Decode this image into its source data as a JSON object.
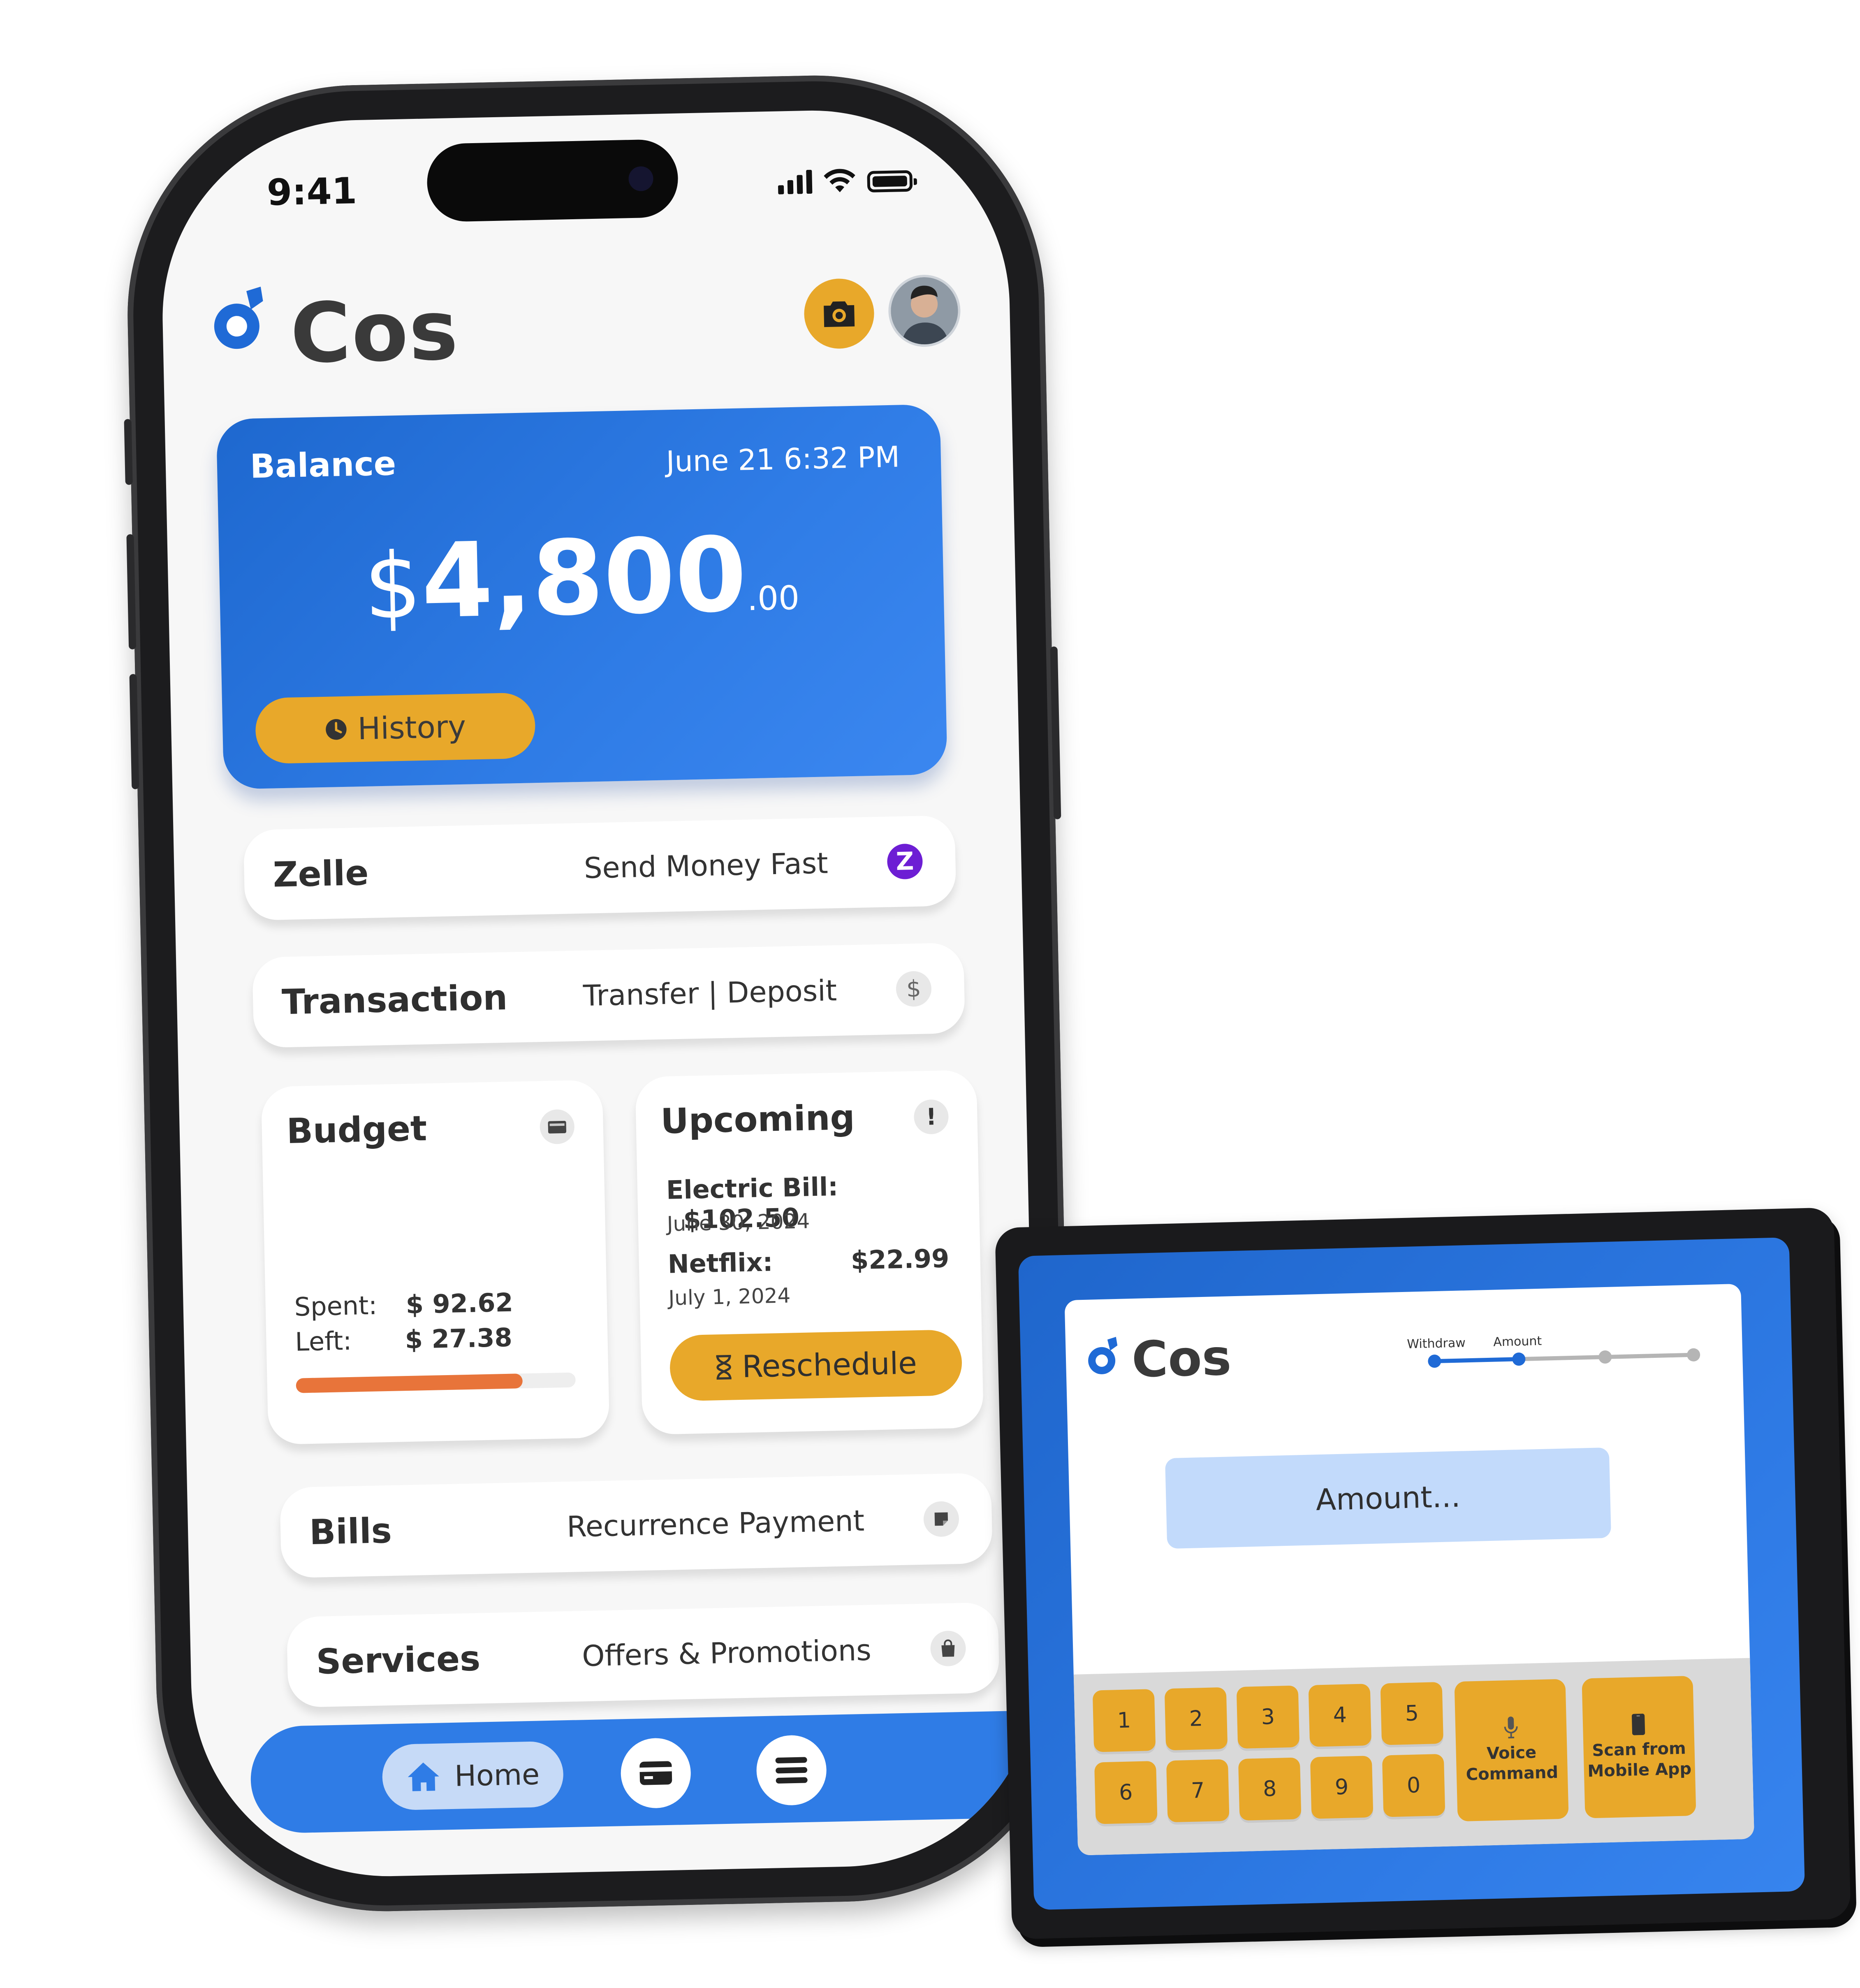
{
  "phone": {
    "status_time": "9:41",
    "app_name": "Cos",
    "balance": {
      "label": "Balance",
      "datetime": "June 21 6:32 PM",
      "currency": "$",
      "amount_whole": "4,800",
      "amount_cents": ".00",
      "history_label": "History"
    },
    "zelle": {
      "title": "Zelle",
      "subtitle": "Send Money Fast",
      "icon_glyph": "Z"
    },
    "transaction": {
      "title": "Transaction",
      "subtitle": "Transfer | Deposit",
      "icon_glyph": "$"
    },
    "budget": {
      "title": "Budget",
      "spent_label": "Spent:",
      "spent_value": "$ 92.62",
      "left_label": "Left:",
      "left_value": "$ 27.38",
      "progress_fraction": 0.81
    },
    "upcoming": {
      "title": "Upcoming",
      "icon_glyph": "!",
      "items": [
        {
          "name": "Electric Bill:",
          "amount": "$102.50",
          "date": "June 30, 2024"
        },
        {
          "name": "Netflix:",
          "amount": "$22.99",
          "date": "July 1, 2024"
        }
      ],
      "reschedule_label": "Reschedule"
    },
    "bills": {
      "title": "Bills",
      "subtitle": "Recurrence Payment"
    },
    "services": {
      "title": "Services",
      "subtitle": "Offers & Promotions"
    },
    "nav": {
      "home_label": "Home"
    }
  },
  "tablet": {
    "app_name": "Cos",
    "steps": {
      "step1": "Withdraw",
      "step2": "Amount",
      "current_index": 2,
      "total_steps": 4
    },
    "amount_placeholder": "Amount...",
    "keys_row1": [
      "1",
      "2",
      "3",
      "4",
      "5"
    ],
    "keys_row2": [
      "6",
      "7",
      "8",
      "9",
      "0"
    ],
    "voice_label": "Voice\nCommand",
    "scan_label": "Scan from\nMobile App"
  },
  "colors": {
    "brand_blue": "#2f7ce6",
    "accent_orange": "#e8a82a",
    "progress_orange": "#e8743a",
    "zelle_purple": "#6d1ed4"
  }
}
